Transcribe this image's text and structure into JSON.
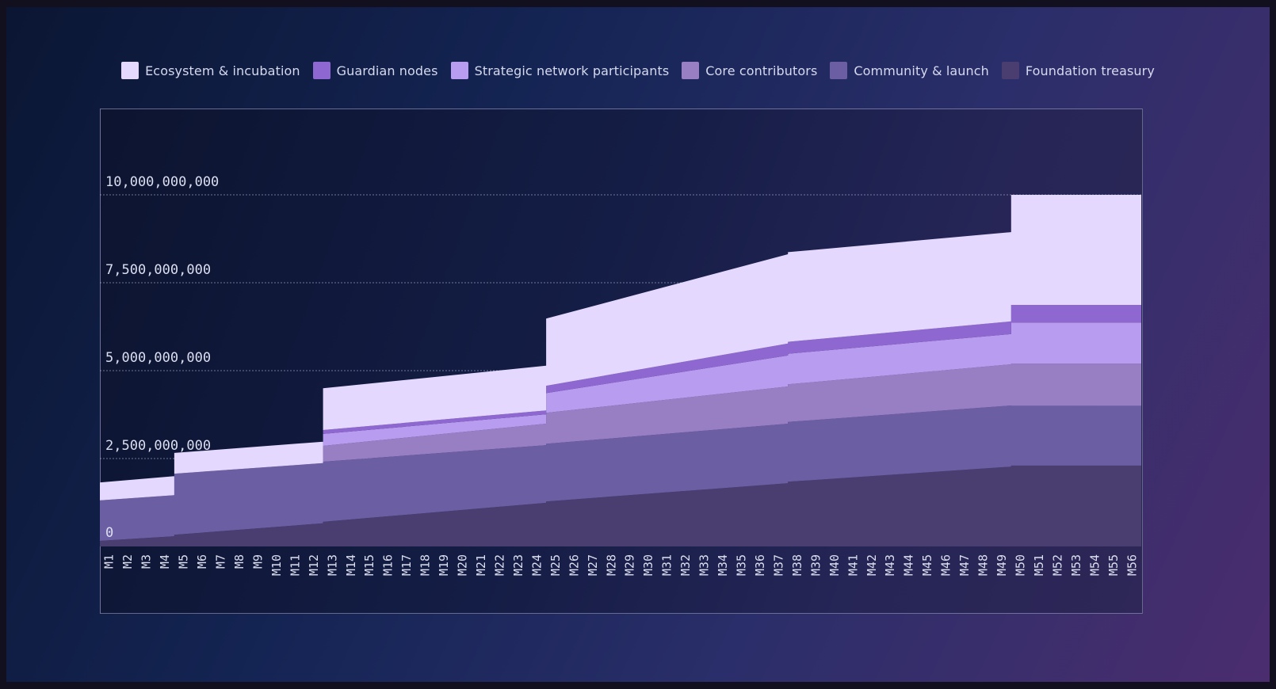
{
  "chart_data": {
    "type": "area",
    "stacked": true,
    "step": true,
    "title": "",
    "xlabel": "",
    "ylabel": "",
    "ylim": [
      0,
      11000000000
    ],
    "yticks": [
      0,
      2500000000,
      5000000000,
      7500000000,
      10000000000
    ],
    "ytick_labels": [
      "0",
      "2,500,000,000",
      "5,000,000,000",
      "7,500,000,000",
      "10,000,000,000"
    ],
    "grid": true,
    "legend_position": "top-center",
    "categories": [
      "M1",
      "M2",
      "M3",
      "M4",
      "M5",
      "M6",
      "M7",
      "M8",
      "M9",
      "M10",
      "M11",
      "M12",
      "M13",
      "M14",
      "M15",
      "M16",
      "M17",
      "M18",
      "M19",
      "M20",
      "M21",
      "M22",
      "M23",
      "M24",
      "M25",
      "M26",
      "M27",
      "M28",
      "M29",
      "M30",
      "M31",
      "M32",
      "M33",
      "M34",
      "M35",
      "M36",
      "M37",
      "M38",
      "M39",
      "M40",
      "M41",
      "M42",
      "M43",
      "M44",
      "M45",
      "M46",
      "M47",
      "M48",
      "M49",
      "M50",
      "M51",
      "M52",
      "M53",
      "M54",
      "M55",
      "M56"
    ],
    "series": [
      {
        "name": "Foundation treasury",
        "color": "#4a3d70",
        "values": [
          0.16,
          0.2,
          0.25,
          0.29,
          0.33,
          0.38,
          0.43,
          0.48,
          0.52,
          0.57,
          0.62,
          0.66,
          0.7,
          0.75,
          0.8,
          0.85,
          0.9,
          0.95,
          1.0,
          1.05,
          1.1,
          1.14,
          1.19,
          1.24,
          1.28,
          1.33,
          1.37,
          1.42,
          1.47,
          1.52,
          1.56,
          1.61,
          1.66,
          1.7,
          1.75,
          1.8,
          1.8,
          1.84,
          1.88,
          1.92,
          1.96,
          2.0,
          2.04,
          2.08,
          2.12,
          2.16,
          2.2,
          2.24,
          2.27,
          2.3,
          2.3,
          2.3,
          2.3,
          2.3,
          2.3,
          2.3
        ]
      },
      {
        "name": "Community & launch",
        "color": "#6b5ea3",
        "values": [
          1.15,
          1.15,
          1.16,
          1.17,
          1.74,
          1.73,
          1.73,
          1.72,
          1.72,
          1.71,
          1.71,
          1.71,
          1.71,
          1.7,
          1.69,
          1.68,
          1.67,
          1.66,
          1.66,
          1.65,
          1.65,
          1.64,
          1.64,
          1.64,
          1.64,
          1.64,
          1.64,
          1.63,
          1.63,
          1.62,
          1.62,
          1.62,
          1.62,
          1.62,
          1.62,
          1.62,
          1.69,
          1.7,
          1.7,
          1.71,
          1.71,
          1.71,
          1.72,
          1.72,
          1.73,
          1.73,
          1.73,
          1.74,
          1.74,
          1.7,
          1.7,
          1.7,
          1.7,
          1.7,
          1.7,
          1.7
        ]
      },
      {
        "name": "Core contributors",
        "color": "#987fc4",
        "values": [
          0,
          0,
          0,
          0,
          0,
          0,
          0,
          0,
          0,
          0,
          0,
          0,
          0.45,
          0.47,
          0.48,
          0.5,
          0.51,
          0.53,
          0.54,
          0.56,
          0.57,
          0.58,
          0.6,
          0.61,
          0.88,
          0.86,
          0.85,
          0.85,
          0.84,
          0.83,
          0.83,
          0.83,
          0.83,
          0.83,
          0.83,
          0.83,
          1.06,
          1.07,
          1.08,
          1.09,
          1.1,
          1.11,
          1.12,
          1.13,
          1.14,
          1.15,
          1.16,
          1.17,
          1.17,
          1.2,
          1.2,
          1.2,
          1.2,
          1.2,
          1.2,
          1.2
        ]
      },
      {
        "name": "Strategic network participants",
        "color": "#b89cf0",
        "values": [
          0,
          0,
          0,
          0,
          0,
          0,
          0,
          0,
          0,
          0,
          0,
          0,
          0.34,
          0.34,
          0.33,
          0.32,
          0.31,
          0.31,
          0.3,
          0.3,
          0.29,
          0.28,
          0.28,
          0.27,
          0.56,
          0.56,
          0.57,
          0.57,
          0.58,
          0.58,
          0.58,
          0.59,
          0.59,
          0.59,
          0.59,
          0.59,
          0.88,
          0.87,
          0.87,
          0.87,
          0.87,
          0.87,
          0.86,
          0.86,
          0.86,
          0.86,
          0.86,
          0.86,
          0.86,
          1.17,
          1.17,
          1.17,
          1.17,
          1.17,
          1.17,
          1.17
        ]
      },
      {
        "name": "Guardian nodes",
        "color": "#8e68d0",
        "values": [
          0,
          0,
          0,
          0,
          0,
          0,
          0,
          0,
          0,
          0,
          0,
          0,
          0.11,
          0.11,
          0.11,
          0.11,
          0.11,
          0.11,
          0.11,
          0.11,
          0.11,
          0.11,
          0.11,
          0.11,
          0.21,
          0.21,
          0.21,
          0.21,
          0.22,
          0.22,
          0.22,
          0.22,
          0.22,
          0.22,
          0.23,
          0.23,
          0.34,
          0.34,
          0.35,
          0.35,
          0.35,
          0.35,
          0.35,
          0.35,
          0.36,
          0.36,
          0.36,
          0.36,
          0.36,
          0.5,
          0.5,
          0.5,
          0.5,
          0.5,
          0.5,
          0.5
        ]
      },
      {
        "name": "Ecosystem & incubation",
        "color": "#e4d8ff",
        "values": [
          0.51,
          0.52,
          0.53,
          0.54,
          0.59,
          0.59,
          0.6,
          0.6,
          0.61,
          0.61,
          0.61,
          0.61,
          1.19,
          1.19,
          1.2,
          1.21,
          1.21,
          1.22,
          1.23,
          1.23,
          1.24,
          1.25,
          1.26,
          1.27,
          1.91,
          1.9,
          1.9,
          1.9,
          1.89,
          1.89,
          1.89,
          1.89,
          1.89,
          1.89,
          1.89,
          1.89,
          2.54,
          2.55,
          2.55,
          2.55,
          2.55,
          2.55,
          2.55,
          2.55,
          2.55,
          2.55,
          2.55,
          2.55,
          2.54,
          3.13,
          3.13,
          3.13,
          3.13,
          3.13,
          3.13,
          3.13
        ]
      }
    ],
    "value_unit": "billions"
  },
  "legend": [
    {
      "label": "Ecosystem & incubation",
      "color": "#e4d8ff"
    },
    {
      "label": "Guardian nodes",
      "color": "#8e68d0"
    },
    {
      "label": "Strategic network participants",
      "color": "#b89cf0"
    },
    {
      "label": "Core contributors",
      "color": "#987fc4"
    },
    {
      "label": "Community & launch",
      "color": "#6b5ea3"
    },
    {
      "label": "Foundation treasury",
      "color": "#4a3d70"
    }
  ]
}
